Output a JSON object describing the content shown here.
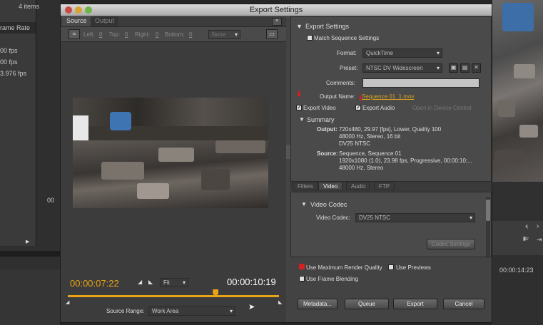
{
  "background": {
    "items_count": "4 items",
    "column_header": "rame Rate",
    "rates": [
      "00 fps",
      "00 fps",
      "3.976 fps"
    ],
    "timecode_right": "00:00:14:23",
    "left_marker": "00"
  },
  "dialog": {
    "title": "Export Settings",
    "left_tabs": [
      "Source",
      "Output"
    ],
    "crop": {
      "left_label": "Left:",
      "left_value": "0",
      "top_label": "Top:",
      "top_value": "0",
      "right_label": "Right:",
      "right_value": "0",
      "bottom_label": "Bottom:",
      "bottom_value": "0",
      "ratio": "None"
    },
    "timeline": {
      "in_timecode": "00:00:07:22",
      "out_timecode": "00:00:10:19",
      "fit": "Fit",
      "source_range_label": "Source Range:",
      "source_range_value": "Work Area",
      "playhead_fraction": 0.7
    }
  },
  "export_settings": {
    "header": "Export Settings",
    "match_label": "Match Sequence Settings",
    "format_label": "Format:",
    "format_value": "QuickTime",
    "preset_label": "Preset:",
    "preset_value": "NTSC DV Widescreen",
    "comments_label": "Comments:",
    "comments_value": "",
    "output_name_label": "Output Name:",
    "output_name_value": "Sequence 01_1.mov",
    "export_video": "Export Video",
    "export_audio": "Export Audio",
    "open_device": "Open in Device Central",
    "summary_header": "Summary",
    "output_label": "Output:",
    "output_lines": [
      "720x480, 29.97 [fps], Lower, Quality 100",
      "48000 Hz, Stereo, 16 bit",
      "DV25 NTSC"
    ],
    "source_label": "Source:",
    "source_lines": [
      "Sequence, Sequence 01",
      "1920x1080 (1.0), 23.98 fps, Progressive, 00:00:10:...",
      "48000 Hz, Stereo"
    ]
  },
  "settings_tabs": [
    "Filters",
    "Video",
    "Audio",
    "FTP"
  ],
  "video": {
    "codec_header": "Video Codec",
    "codec_label": "Video Codec:",
    "codec_value": "DV25 NTSC",
    "codec_settings": "Codec Settings"
  },
  "bottom": {
    "max_render": "Use Maximum Render Quality",
    "previews": "Use Previews",
    "frame_blending": "Use Frame Blending",
    "metadata": "Metadata...",
    "queue": "Queue",
    "export": "Export",
    "cancel": "Cancel"
  },
  "colors": {
    "accent": "#e8a317",
    "output_name": "#d9a420",
    "red_arrow": "#d42020"
  }
}
